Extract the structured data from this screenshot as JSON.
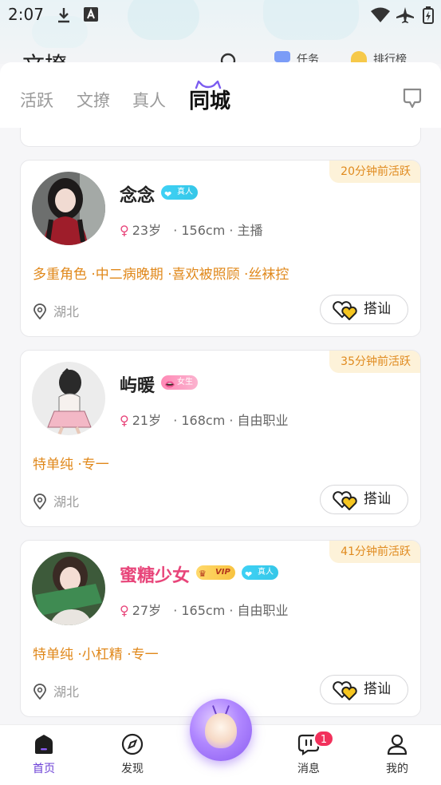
{
  "status_bar": {
    "time": "2:07"
  },
  "header_peek": {
    "title": "文撩",
    "task_label": "任务",
    "rank_label": "排行榜"
  },
  "tabs": [
    {
      "label": "活跃",
      "active": false
    },
    {
      "label": "文撩",
      "active": false
    },
    {
      "label": "真人",
      "active": false
    },
    {
      "label": "同城",
      "active": true
    }
  ],
  "cards": [
    {
      "active_time": "20分钟前活跃",
      "name": "念念",
      "badges": [
        "真人"
      ],
      "age": "23岁",
      "height": "· 156cm",
      "job": "· 主播",
      "tags": "多重角色 ·中二病晚期 ·喜欢被照顾 ·丝袜控",
      "location": "湖北",
      "chat_label": "搭讪"
    },
    {
      "active_time": "35分钟前活跃",
      "name": "屿暖",
      "badges": [
        "女生"
      ],
      "age": "21岁",
      "height": "· 168cm",
      "job": "· 自由职业",
      "tags": "特单纯 ·专一",
      "location": "湖北",
      "chat_label": "搭讪"
    },
    {
      "active_time": "41分钟前活跃",
      "name": "蜜糖少女",
      "badges": [
        "VIP",
        "真人"
      ],
      "age": "27岁",
      "height": "· 165cm",
      "job": "· 自由职业",
      "tags": "特单纯 ·小杠精 ·专一",
      "location": "湖北",
      "chat_label": "搭讪"
    }
  ],
  "bottom_nav": [
    {
      "label": "首页",
      "active": true
    },
    {
      "label": "发现",
      "active": false
    },
    {
      "label": "消息",
      "active": false,
      "badge": "1"
    },
    {
      "label": "我的",
      "active": false
    }
  ],
  "colors": {
    "accent": "#6b3fd6",
    "active_tag_text": "#e08a1e",
    "tags_text": "#e0881b",
    "vip_name": "#e8457a",
    "badge_red": "#f2315c"
  }
}
